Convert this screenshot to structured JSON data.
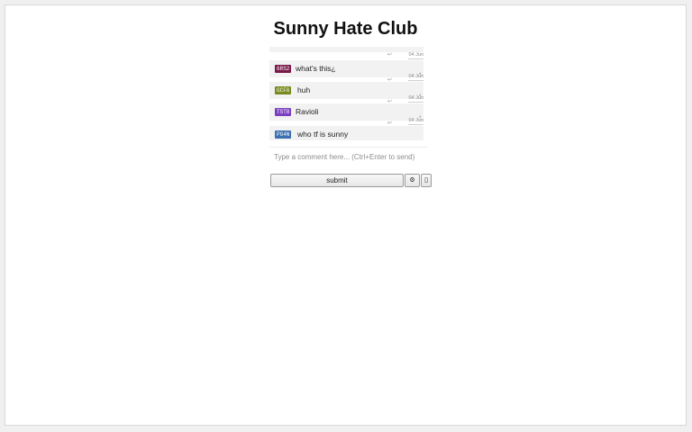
{
  "page": {
    "title": "Sunny Hate Club"
  },
  "chat": {
    "messages": [
      {
        "tag": "",
        "tag_color": "#888888",
        "text": "",
        "date": ""
      },
      {
        "tag": "6RS2",
        "tag_color": "#7a1a4a",
        "text": "what's this¿",
        "date": "04 Jun"
      },
      {
        "tag": "GCFG",
        "tag_color": "#7a8a1e",
        "text": "huh",
        "date": "04 Jun"
      },
      {
        "tag": "TST8",
        "tag_color": "#7a3fc0",
        "text": "Ravioli",
        "date": "04 Jun"
      },
      {
        "tag": "PG4N",
        "tag_color": "#3a6fb0",
        "text": "who tf is sunny",
        "date": "04 Jun"
      }
    ],
    "reply_glyph": "↩",
    "dot_glyph": "•"
  },
  "composer": {
    "placeholder": "Type a comment here... (Ctrl+Enter to send)",
    "value": ""
  },
  "controls": {
    "submit_label": "submit",
    "settings_glyph": "⚙",
    "extra_glyph": "▯",
    "settings_icon": "gear-icon",
    "extra_icon": "box-icon"
  }
}
